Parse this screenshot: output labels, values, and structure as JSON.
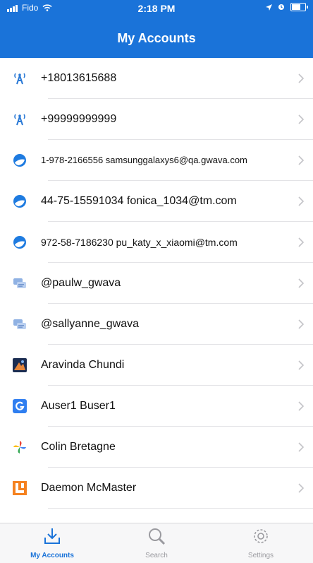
{
  "status_bar": {
    "carrier": "Fido",
    "time": "2:18 PM"
  },
  "header": {
    "title": "My Accounts"
  },
  "accounts": [
    {
      "label": "+18013615688",
      "icon": "antenna-icon"
    },
    {
      "label": "+99999999999",
      "icon": "antenna-icon"
    },
    {
      "label": "1-978-2166556 samsunggalaxys6@qa.gwava.com",
      "icon": "globe-chat-icon"
    },
    {
      "label": "44-75-15591034 fonica_1034@tm.com",
      "icon": "globe-chat-icon"
    },
    {
      "label": "972-58-7186230 pu_katy_x_xiaomi@tm.com",
      "icon": "globe-chat-icon"
    },
    {
      "label": "@paulw_gwava",
      "icon": "message-bubbles-icon"
    },
    {
      "label": "@sallyanne_gwava",
      "icon": "message-bubbles-icon"
    },
    {
      "label": "Aravinda Chundi",
      "icon": "photo-app-icon"
    },
    {
      "label": "Auser1 Buser1",
      "icon": "g-letter-icon"
    },
    {
      "label": "Colin Bretagne",
      "icon": "pinwheel-icon"
    },
    {
      "label": "Daemon McMaster",
      "icon": "l-letter-icon"
    }
  ],
  "tabs": [
    {
      "label": "My Accounts",
      "icon": "download-tray-icon",
      "active": true
    },
    {
      "label": "Search",
      "icon": "magnifier-icon",
      "active": false
    },
    {
      "label": "Settings",
      "icon": "gear-icon",
      "active": false
    }
  ],
  "colors": {
    "header": "#1a73d9",
    "tab_active": "#1a73d9",
    "tab_inactive": "#9a9a9f"
  }
}
